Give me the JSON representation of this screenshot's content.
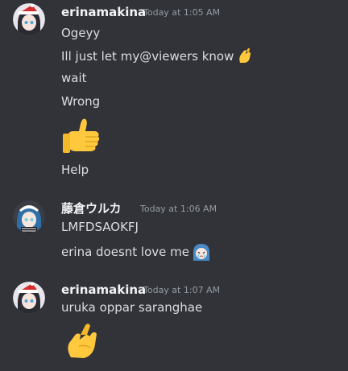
{
  "colors": {
    "background": "#313338",
    "username": "#f2f3f5",
    "timestamp": "#949ba4",
    "message_text": "#dbdee1",
    "emoji_yellow": "#ffc83d"
  },
  "messages": [
    {
      "username": "erinamakina",
      "timestamp": "Today at 1:05 AM",
      "avatar_icon": "santa-hat-girl-avatar",
      "lines": [
        "Ogeyy",
        "Ill just let my@viewers know",
        "wait",
        "Wrong",
        "Help"
      ],
      "inline_emoji_icon": "pinched-finger-heart-emoji",
      "big_emoji_icon": "thumbs-up-emoji"
    },
    {
      "username": "藤倉ウルカ",
      "timestamp": "Today at 1:06 AM",
      "avatar_icon": "blue-hair-girl-avatar",
      "lines": [
        "LMFDSAOKFJ",
        "erina doesnt love me"
      ],
      "inline_emoji_icon": "crying-girl-emote"
    },
    {
      "username": "erinamakina",
      "timestamp": "Today at 1:07 AM",
      "avatar_icon": "santa-hat-girl-avatar",
      "lines": [
        "uruka oppar saranghae"
      ],
      "big_emoji_icon": "finger-heart-emoji"
    }
  ]
}
